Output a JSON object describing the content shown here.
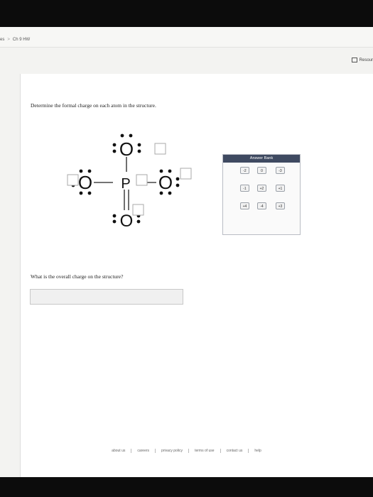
{
  "breadcrumb": {
    "prev": "es",
    "current": "Ch 9 HW"
  },
  "resources_label": "Resour",
  "question1": "Determine the formal charge on each atom in the structure.",
  "question2": "What is the overall charge on the structure?",
  "molecule": {
    "atoms": {
      "top": "O",
      "left": "O",
      "center": "P",
      "right": "O",
      "bottom": "O"
    }
  },
  "answer_bank": {
    "title": "Answer Bank",
    "chips": [
      "-2",
      "0",
      "-3",
      "-1",
      "+2",
      "+1",
      "+4",
      "-4",
      "+3"
    ]
  },
  "overall_charge_value": "",
  "footer": [
    "about us",
    "careers",
    "privacy policy",
    "terms of use",
    "contact us",
    "help"
  ]
}
